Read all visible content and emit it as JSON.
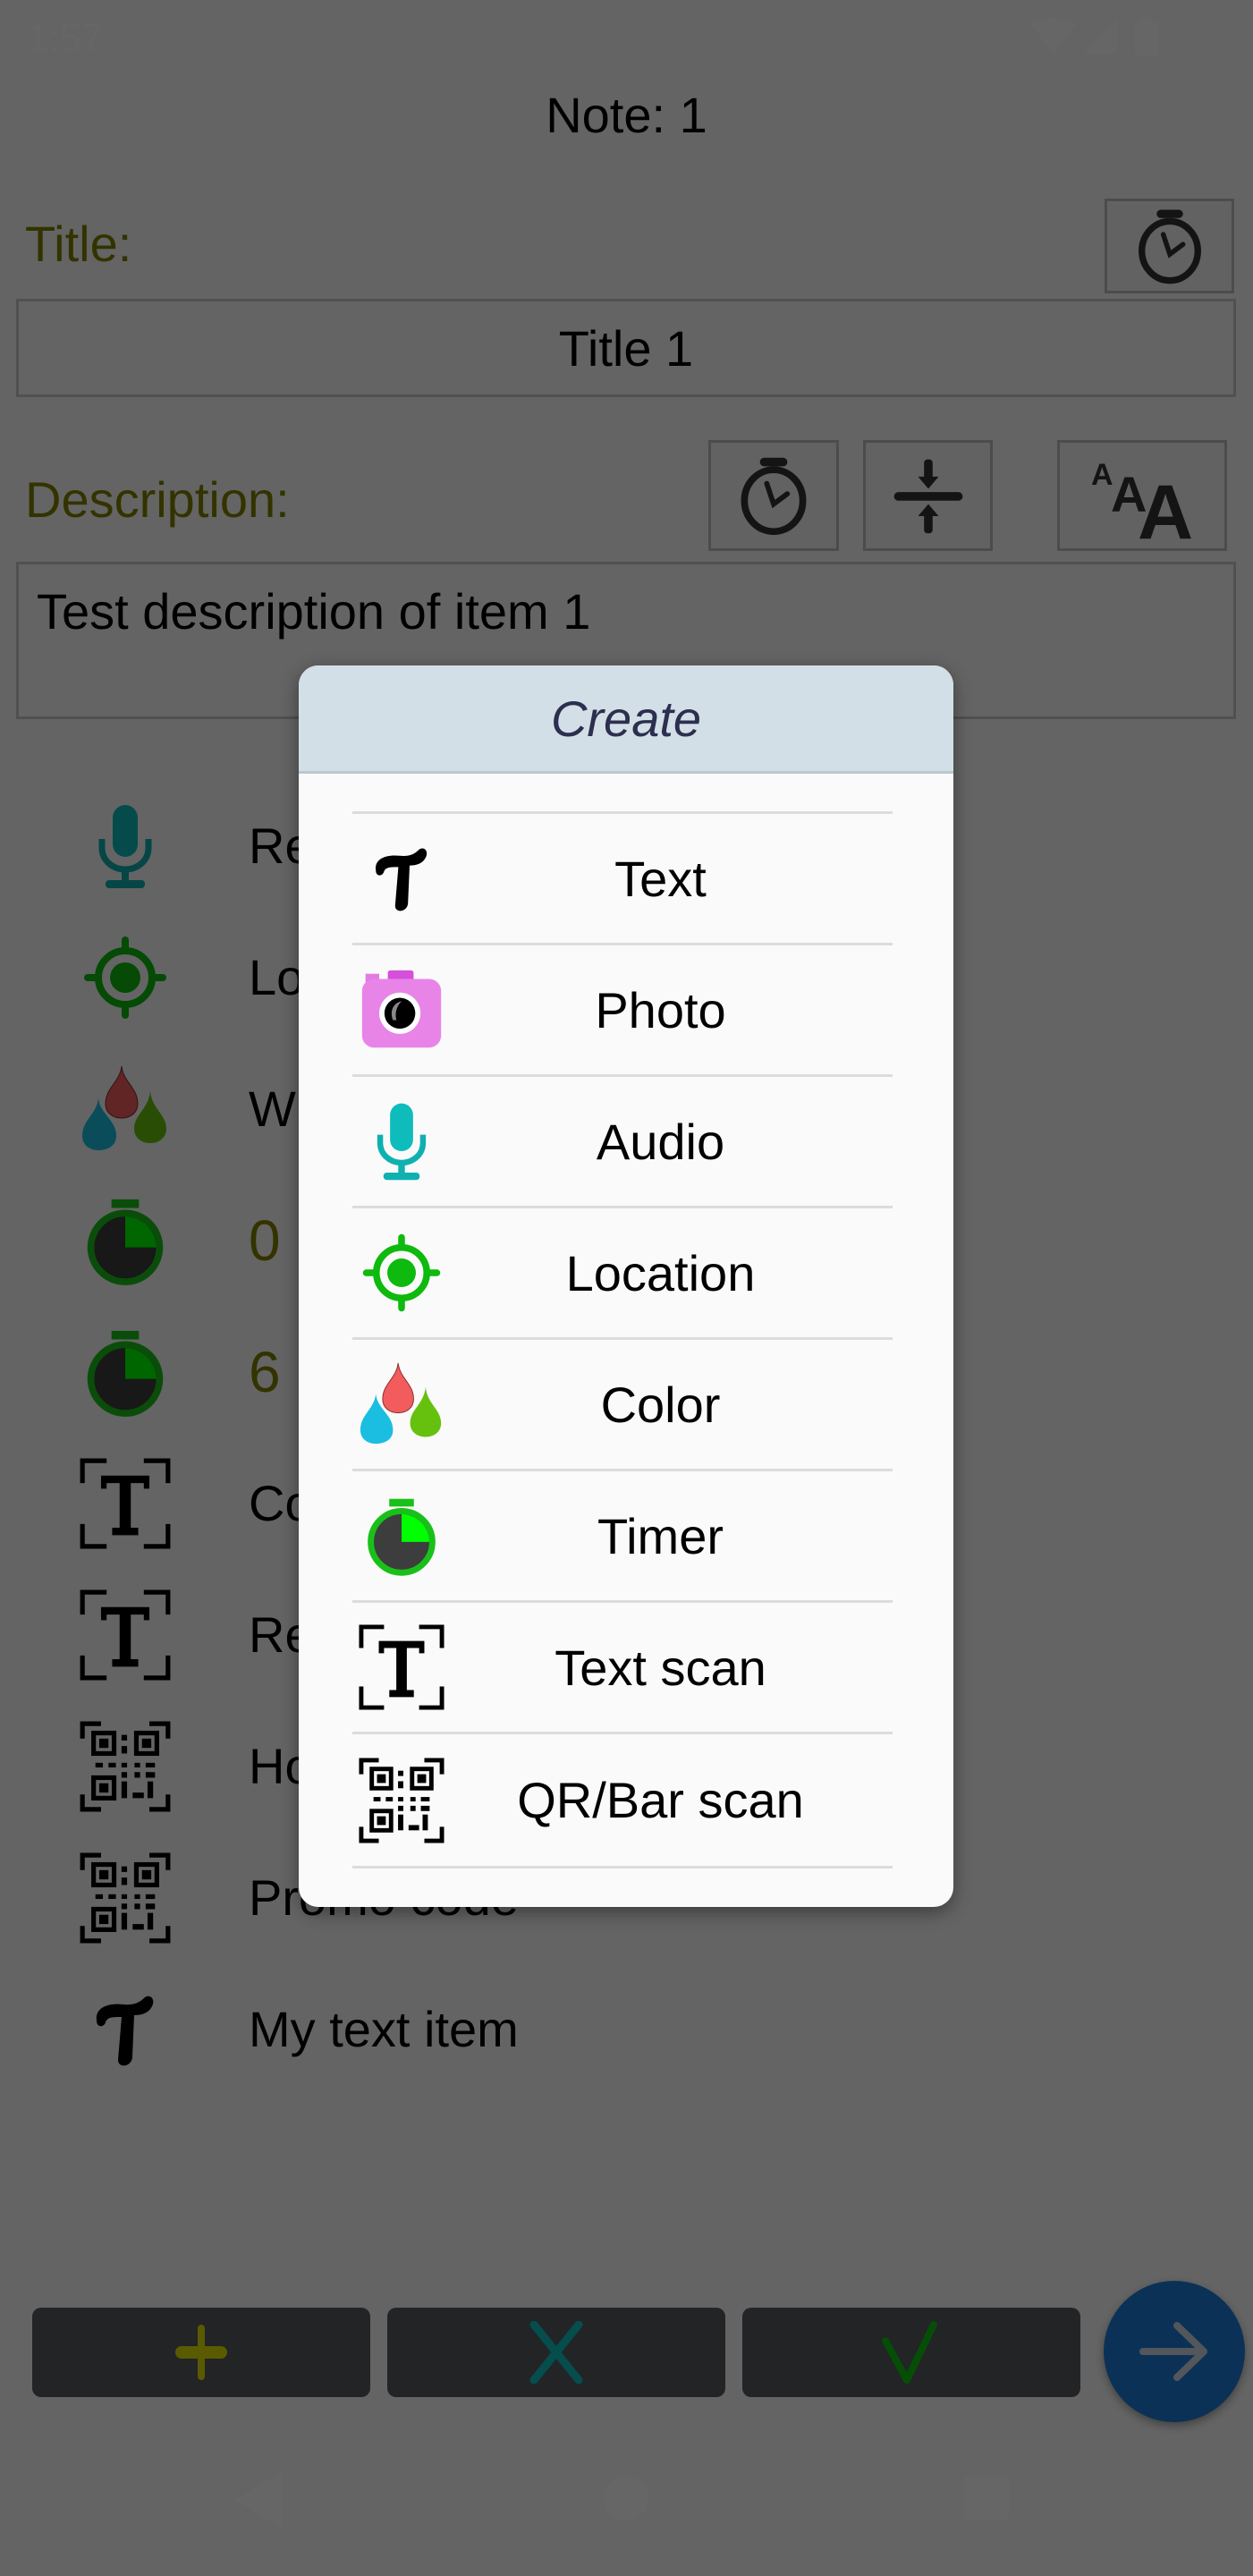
{
  "status_bar": {
    "time": "1:57",
    "icons": [
      "wifi-icon",
      "signal-icon",
      "battery-icon"
    ]
  },
  "header": {
    "title": "Note: 1"
  },
  "title_section": {
    "label": "Title:",
    "value": "Title 1",
    "timer_button_icon": "stopwatch-icon"
  },
  "description_section": {
    "label": "Description:",
    "value": "Test description of item 1",
    "buttons": [
      {
        "icon": "stopwatch-icon"
      },
      {
        "icon": "collapse-vertical-icon"
      },
      {
        "icon": "font-size-icon"
      }
    ]
  },
  "items": [
    {
      "icon": "microphone-icon",
      "text": "Re"
    },
    {
      "icon": "location-target-icon",
      "text": "Lo"
    },
    {
      "icon": "color-drops-icon",
      "text": "W"
    },
    {
      "icon": "timer-icon",
      "text": "0",
      "numeric": true
    },
    {
      "icon": "timer-icon",
      "text": "6",
      "numeric": true
    },
    {
      "icon": "text-scan-icon",
      "text": "Co"
    },
    {
      "icon": "text-scan-icon",
      "text": "Re"
    },
    {
      "icon": "qr-scan-icon",
      "text": "Ho"
    },
    {
      "icon": "qr-scan-icon",
      "text": "Promo code"
    },
    {
      "icon": "text-icon",
      "text": "My text item"
    }
  ],
  "bottom_bar": {
    "add_icon": "plus-icon",
    "cancel_icon": "x-icon",
    "confirm_icon": "check-icon",
    "next_icon": "arrow-right-icon"
  },
  "nav_bar": {
    "back": "back-icon",
    "home": "home-icon",
    "recents": "recents-icon"
  },
  "dialog": {
    "title": "Create",
    "options": [
      {
        "label": "Text",
        "icon": "text-icon"
      },
      {
        "label": "Photo",
        "icon": "camera-icon"
      },
      {
        "label": "Audio",
        "icon": "microphone-icon"
      },
      {
        "label": "Location",
        "icon": "location-target-icon"
      },
      {
        "label": "Color",
        "icon": "color-drops-icon"
      },
      {
        "label": "Timer",
        "icon": "timer-icon"
      },
      {
        "label": "Text scan",
        "icon": "text-scan-icon"
      },
      {
        "label": "QR/Bar scan",
        "icon": "qr-scan-icon"
      }
    ]
  },
  "colors": {
    "label_olive": "#808000",
    "fab_blue": "#1c7ed6",
    "dialog_header_bg": "#d2dfe6",
    "dialog_title": "#2c2f4e",
    "timer_green": "#19c019",
    "mic_teal": "#0fbcbc",
    "location_green": "#0dba0d",
    "camera_pink": "#e67ee6"
  }
}
